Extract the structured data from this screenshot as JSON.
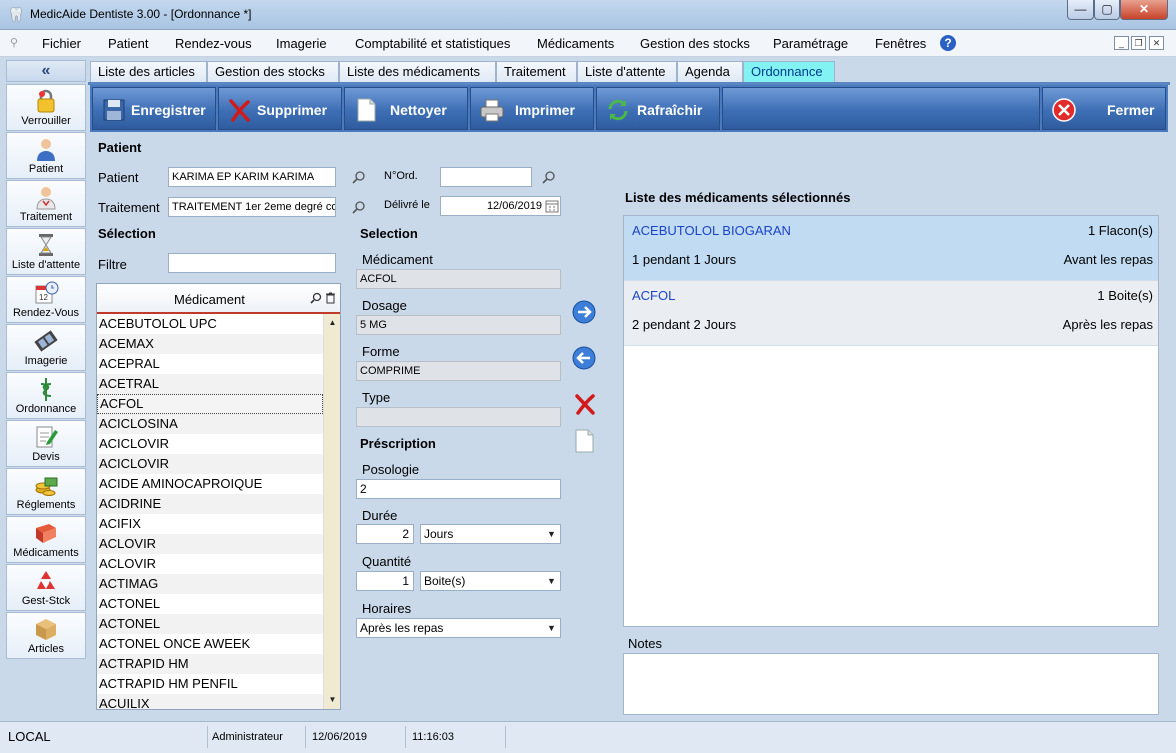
{
  "window": {
    "title": "MedicAide Dentiste 3.00  - [Ordonnance *]",
    "min_glyph": "—",
    "max_glyph": "▢",
    "close_glyph": "✕"
  },
  "menu": {
    "items": [
      "Fichier",
      "Patient",
      "Rendez-vous",
      "Imagerie",
      "Comptabilité et statistiques",
      "Médicaments",
      "Gestion des stocks",
      "Paramétrage",
      "Fenêtres"
    ],
    "help_glyph": "?",
    "mdi_min": "_",
    "mdi_restore": "❐",
    "mdi_close": "✕"
  },
  "sidebar": {
    "collapse_glyph": "«",
    "items": [
      {
        "label": "Verrouiller",
        "icon": "lock-icon"
      },
      {
        "label": "Patient",
        "icon": "patient-icon"
      },
      {
        "label": "Traitement",
        "icon": "treatment-icon"
      },
      {
        "label": "Liste d'attente",
        "icon": "hourglass-icon"
      },
      {
        "label": "Rendez-Vous",
        "icon": "calendar-icon"
      },
      {
        "label": "Imagerie",
        "icon": "film-icon"
      },
      {
        "label": "Ordonnance",
        "icon": "caduceus-icon"
      },
      {
        "label": "Devis",
        "icon": "quote-icon"
      },
      {
        "label": "Réglements",
        "icon": "coins-icon"
      },
      {
        "label": "Médicaments",
        "icon": "book-icon"
      },
      {
        "label": "Gest-Stck",
        "icon": "recycle-icon"
      },
      {
        "label": "Articles",
        "icon": "box-icon"
      }
    ]
  },
  "tabs": [
    {
      "label": "Liste des articles",
      "active": false
    },
    {
      "label": "Gestion des stocks",
      "active": false
    },
    {
      "label": "Liste des médicaments",
      "active": false
    },
    {
      "label": "Traitement",
      "active": false
    },
    {
      "label": "Liste d'attente",
      "active": false
    },
    {
      "label": "Agenda",
      "active": false
    },
    {
      "label": "Ordonnance",
      "active": true
    }
  ],
  "toolbar": {
    "save": "Enregistrer",
    "delete": "Supprimer",
    "clear": "Nettoyer",
    "print": "Imprimer",
    "refresh": "Rafraîchir",
    "close": "Fermer"
  },
  "patient_section": {
    "heading": "Patient",
    "patient_label": "Patient",
    "patient_value": "KARIMA EP KARIM  KARIMA",
    "treatment_label": "Traitement",
    "treatment_value": "TRAITEMENT 1er 2eme degré  co",
    "ord_label": "N°Ord.",
    "ord_value": "",
    "delivered_label": "Délivré le",
    "delivered_value": "12/06/2019"
  },
  "selection": {
    "heading": "Sélection",
    "filter_label": "Filtre",
    "filter_value": "",
    "column_header": "Médicament",
    "medications": [
      "ACEBUTOLOL UPC",
      "ACEMAX",
      "ACEPRAL",
      "ACETRAL",
      "ACFOL",
      "ACICLOSINA",
      "ACICLOVIR",
      "ACICLOVIR",
      "ACIDE AMINOCAPROIQUE",
      "ACIDRINE",
      "ACIFIX",
      "ACLOVIR",
      "ACLOVIR",
      "ACTIMAG",
      "ACTONEL",
      "ACTONEL",
      "ACTONEL ONCE  AWEEK",
      "ACTRAPID HM",
      "ACTRAPID HM PENFIL",
      "ACUILIX"
    ],
    "selected_index": 4
  },
  "detail": {
    "heading": "Selection",
    "medicament_label": "Médicament",
    "medicament_value": "ACFOL",
    "dosage_label": "Dosage",
    "dosage_value": "5  MG",
    "form_label": "Forme",
    "form_value": "COMPRIME",
    "type_label": "Type",
    "type_value": ""
  },
  "prescription": {
    "heading": "Préscription",
    "posology_label": "Posologie",
    "posology_value": "2",
    "duration_label": "Durée",
    "duration_value": "2",
    "duration_unit": "Jours",
    "quantity_label": "Quantité",
    "quantity_value": "1",
    "quantity_unit": "Boite(s)",
    "schedule_label": "Horaires",
    "schedule_value": "Après les repas"
  },
  "selected_list": {
    "heading": "Liste des médicaments sélectionnés",
    "items": [
      {
        "name": "ACEBUTOLOL BIOGARAN",
        "quantity": "1 Flacon(s)",
        "description": "1 pendant 1 Jours",
        "timing": "Avant les repas"
      },
      {
        "name": "ACFOL",
        "quantity": "1 Boite(s)",
        "description": "2 pendant 2 Jours",
        "timing": "Après les repas"
      }
    ]
  },
  "notes": {
    "label": "Notes",
    "value": ""
  },
  "status": {
    "location": "LOCAL",
    "user": "Administrateur",
    "date": "12/06/2019",
    "time": "11:16:03"
  }
}
